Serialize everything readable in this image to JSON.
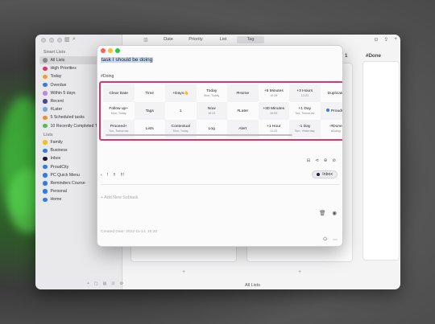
{
  "sidebar": {
    "smart_lists_label": "Smart Lists",
    "smart_lists": [
      {
        "label": "All Lists",
        "color": "#8a8a8e",
        "selected": true
      },
      {
        "label": "High Priorities",
        "color": "#e8316a"
      },
      {
        "label": "Today",
        "color": "#f0a030"
      },
      {
        "label": "Overdue",
        "color": "#2f7be8"
      },
      {
        "label": "Within 5 days",
        "color": "#b98be0"
      },
      {
        "label": "Recent",
        "color": "#4a4a90"
      },
      {
        "label": "#Later",
        "color": "#7aa8e8"
      },
      {
        "label": "5 Scheduled tasks",
        "color": "#e89030"
      },
      {
        "label": "10 Recently Completed T...",
        "color": "#58b858"
      }
    ],
    "lists_label": "Lists",
    "lists": [
      {
        "label": "Family",
        "color": "#f0c020"
      },
      {
        "label": "Business",
        "color": "#2f7be8"
      },
      {
        "label": "Inbox",
        "color": "#1a1a2a"
      },
      {
        "label": "ProudCity",
        "color": "#2f7be8"
      },
      {
        "label": "PC Quick Menu",
        "color": "#2f7be8"
      },
      {
        "label": "Reminders Course",
        "color": "#2f7be8"
      },
      {
        "label": "Personal",
        "color": "#2f7be8"
      },
      {
        "label": "Home",
        "color": "#2f7be8"
      }
    ],
    "bottom_icons": [
      "+",
      "▢",
      "▤",
      "⊡",
      "⚙"
    ]
  },
  "toolbar": {
    "tabs": [
      "Date",
      "Priority",
      "List",
      "Tag"
    ],
    "active_tab": "Tag",
    "right_icons": [
      "⊙",
      "⇪",
      "+"
    ]
  },
  "board": {
    "col_done_header": "#Done",
    "col_number": "1",
    "add_labels": [
      "+",
      "+"
    ],
    "footer": "All Lists"
  },
  "detail": {
    "title": "task I should be doing",
    "tag": "#Doing",
    "quick_actions": [
      {
        "label": "Clear Date",
        "sub": ""
      },
      {
        "label": "Time",
        "sub": ""
      },
      {
        "label": "+Days🤙",
        "sub": ""
      },
      {
        "label": "Today",
        "sub": "Mon, Today"
      },
      {
        "label": "#Home",
        "sub": ""
      },
      {
        "label": "+5 Minutes",
        "sub": "10:28"
      },
      {
        "label": "+3 Hours",
        "sub": "13:23"
      },
      {
        "label": "Duplicate",
        "sub": ""
      },
      {
        "label": "",
        "sub": ""
      },
      {
        "label": "Follow up+",
        "sub": "Mon, Today"
      },
      {
        "label": "Tags",
        "sub": ""
      },
      {
        "label": "1",
        "sub": ""
      },
      {
        "label": "Now",
        "sub": "10:23"
      },
      {
        "label": "#Later",
        "sub": ""
      },
      {
        "label": "+30 Minutes",
        "sub": "10:53"
      },
      {
        "label": "+1 Day",
        "sub": "Tue, Tomorrow"
      },
      {
        "label": "ProudCi",
        "sub": "",
        "dot": true
      },
      {
        "label": "",
        "sub": ""
      },
      {
        "label": "Proceed+",
        "sub": "Tue, Tomorrow"
      },
      {
        "label": "Lists",
        "sub": ""
      },
      {
        "label": "Contextual",
        "sub": "Mon, Today"
      },
      {
        "label": "Log",
        "sub": ""
      },
      {
        "label": "Alert",
        "sub": ""
      },
      {
        "label": "+1 Hour",
        "sub": "11:23"
      },
      {
        "label": "-1 Day",
        "sub": "Sun, Yesterday"
      },
      {
        "label": "-#Done",
        "sub": "#Doing"
      },
      {
        "label": "",
        "sub": ""
      }
    ],
    "action_icons": [
      "⊟",
      "⊲",
      "⊕",
      "⊘"
    ],
    "priority_items": [
      "‹",
      "!",
      "!!",
      "!!!"
    ],
    "list_button": "Inbox",
    "add_subtask": "+ Add New Subtask",
    "mid_icons": [
      "🗑",
      "◉"
    ],
    "created": "Created Date: 2022-11-14, 10:20",
    "bottom_icons": [
      "⏻",
      "⋯"
    ]
  }
}
